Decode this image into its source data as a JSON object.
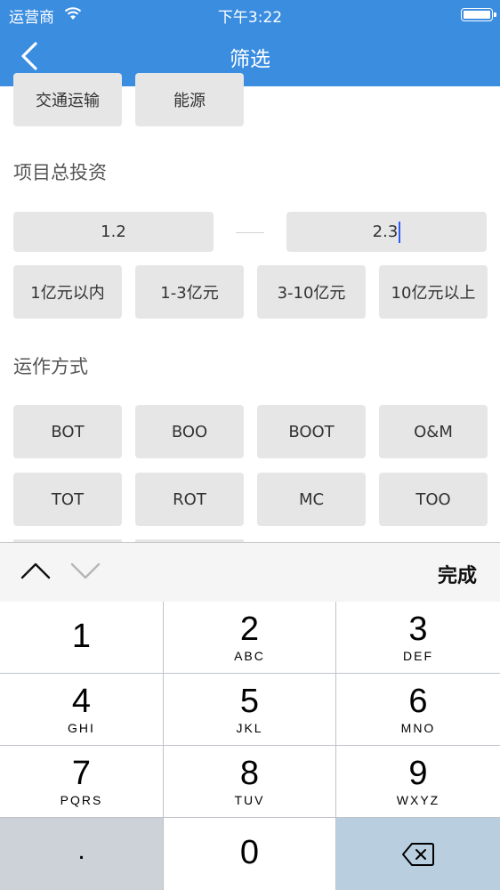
{
  "status_bar": {
    "carrier": "运营商",
    "time": "下午3:22"
  },
  "nav": {
    "title": "筛选"
  },
  "industry": {
    "chips": [
      "交通运输",
      "能源"
    ]
  },
  "investment": {
    "label": "项目总投资",
    "min_value": "1.2",
    "max_value": "2.3",
    "options": [
      "1亿元以内",
      "1-3亿元",
      "3-10亿元",
      "10亿元以上"
    ]
  },
  "operation": {
    "label": "运作方式",
    "row1": [
      "BOT",
      "BOO",
      "BOOT",
      "O&M"
    ],
    "row2": [
      "TOT",
      "ROT",
      "MC",
      "TOO"
    ]
  },
  "accessory": {
    "done_label": "完成"
  },
  "keypad": {
    "keys": [
      {
        "num": "1",
        "letters": ""
      },
      {
        "num": "2",
        "letters": "ABC"
      },
      {
        "num": "3",
        "letters": "DEF"
      },
      {
        "num": "4",
        "letters": "GHI"
      },
      {
        "num": "5",
        "letters": "JKL"
      },
      {
        "num": "6",
        "letters": "MNO"
      },
      {
        "num": "7",
        "letters": "PQRS"
      },
      {
        "num": "8",
        "letters": "TUV"
      },
      {
        "num": "9",
        "letters": "WXYZ"
      }
    ],
    "dot": ".",
    "zero": "0"
  }
}
